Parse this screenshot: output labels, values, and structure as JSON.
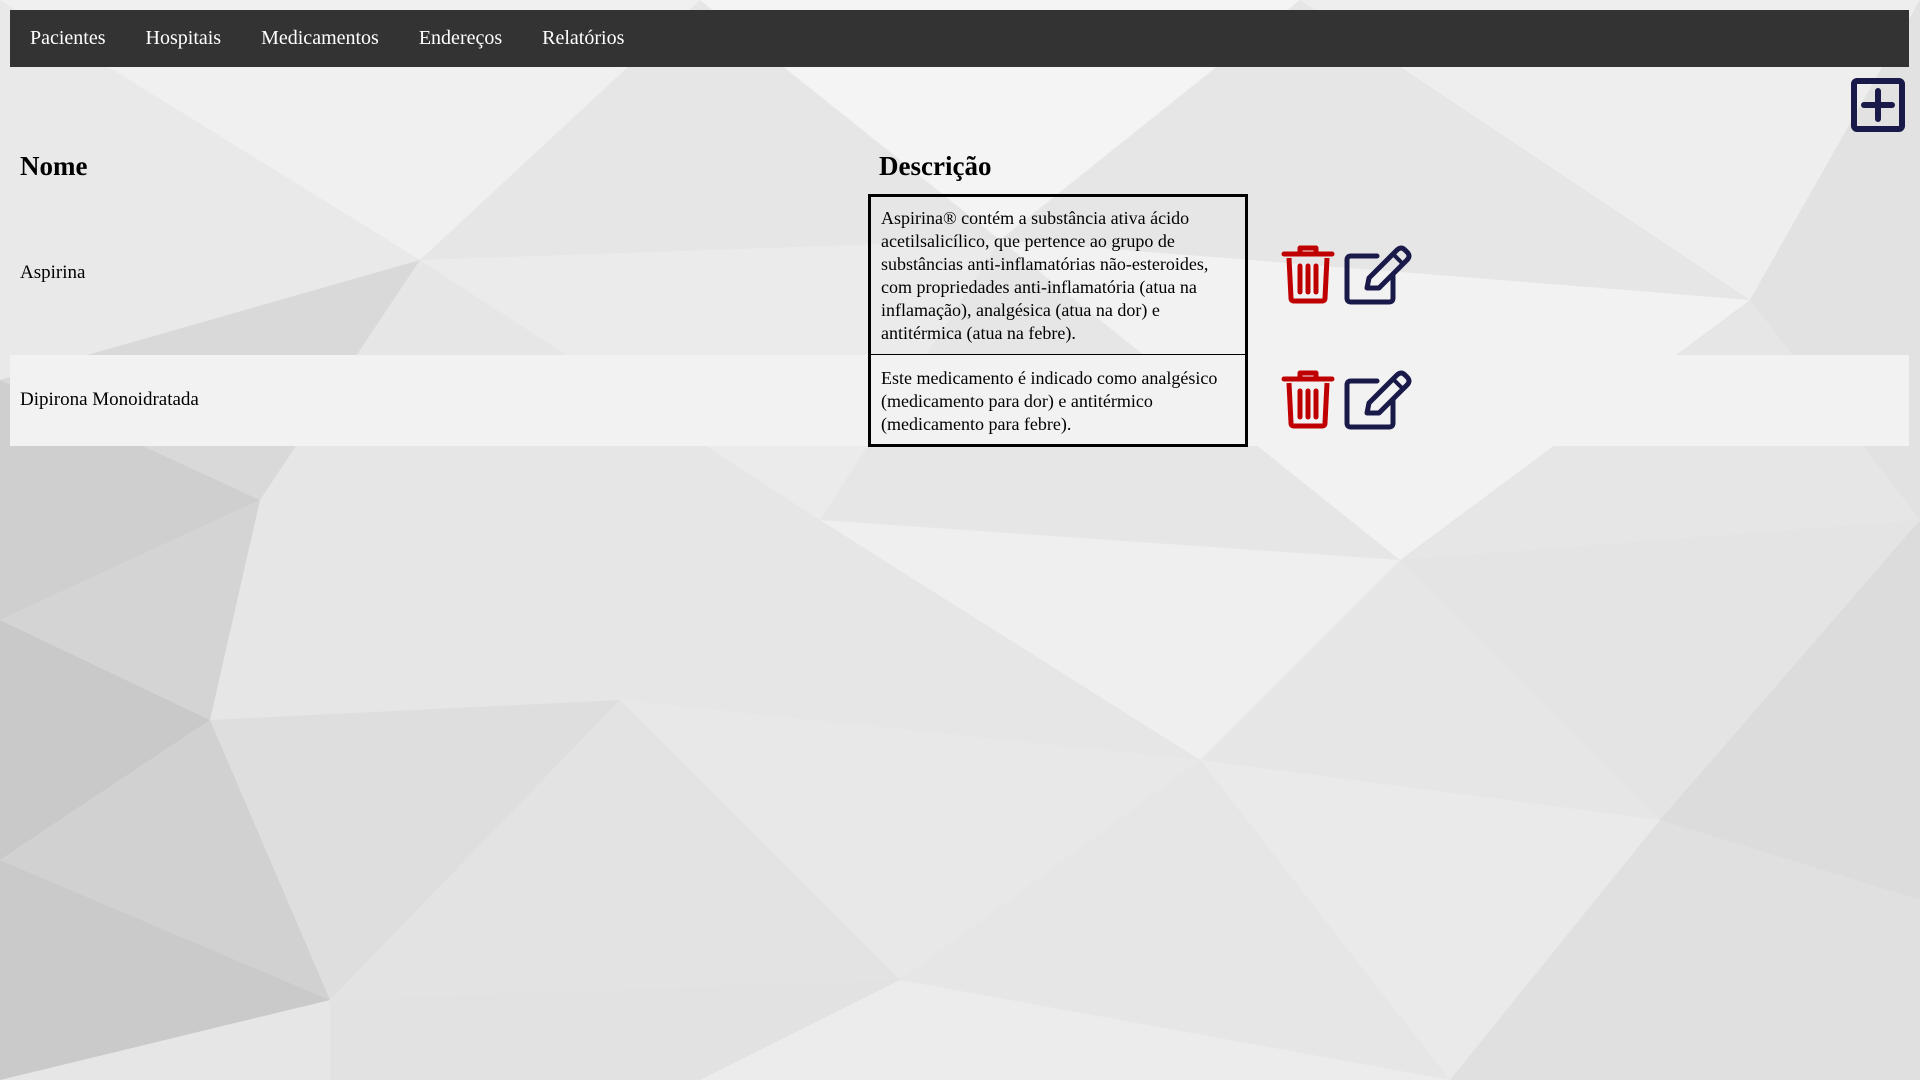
{
  "nav": {
    "items": [
      {
        "label": "Pacientes"
      },
      {
        "label": "Hospitais"
      },
      {
        "label": "Medicamentos"
      },
      {
        "label": "Endereços"
      },
      {
        "label": "Relatórios"
      }
    ]
  },
  "table": {
    "headers": {
      "name": "Nome",
      "description": "Descrição"
    },
    "rows": [
      {
        "name": "Aspirina",
        "description": "Aspirina® contém a substância ativa ácido acetilsalicílico, que pertence ao grupo de substâncias anti-inflamatórias não-esteroides, com propriedades anti-inflamatória (atua na inflamação), analgésica (atua na dor) e antitérmica (atua na febre)."
      },
      {
        "name": "Dipirona Monoidratada",
        "description": "Este medicamento é indicado como analgésico (medicamento para dor) e antitérmico (medicamento para febre)."
      }
    ]
  },
  "icons": {
    "add": "plus-square-icon",
    "delete": "trash-icon",
    "edit": "pencil-square-icon"
  },
  "colors": {
    "navbar_bg": "#333333",
    "nav_text": "#ffffff",
    "delete_icon": "#c00000",
    "edit_icon": "#1a1a4a",
    "add_icon": "#1a1a4a",
    "alt_row_bg": "#f2f2f2"
  }
}
